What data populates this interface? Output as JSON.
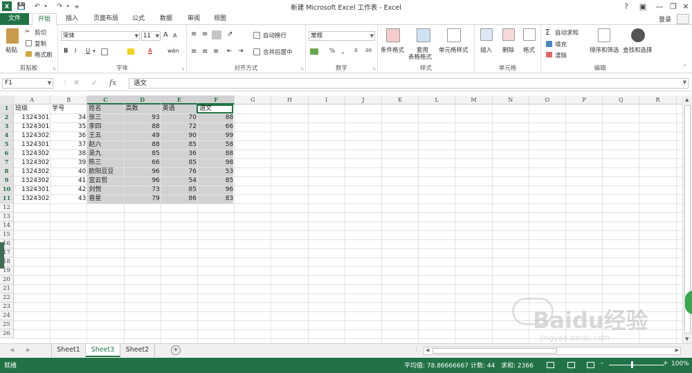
{
  "window": {
    "title": "新建 Microsoft Excel 工作表 - Excel",
    "help": "?",
    "login": "登录"
  },
  "tabs": [
    {
      "label": "文件"
    },
    {
      "label": "开始"
    },
    {
      "label": "插入"
    },
    {
      "label": "页面布局"
    },
    {
      "label": "公式"
    },
    {
      "label": "数据"
    },
    {
      "label": "审阅"
    },
    {
      "label": "视图"
    }
  ],
  "ribbon": {
    "clipboard": {
      "label": "剪贴板",
      "paste": "粘贴",
      "cut": "剪切",
      "copy": "复制",
      "format_painter": "格式刷"
    },
    "font": {
      "label": "字体",
      "font_name": "宋体",
      "font_size": "11",
      "bold": "B",
      "italic": "I",
      "underline": "U",
      "grow": "A",
      "shrink": "A",
      "font_color": "A"
    },
    "alignment": {
      "label": "对齐方式",
      "wrap": "自动换行",
      "merge": "合并后居中"
    },
    "number": {
      "label": "数字",
      "format": "常规",
      "percent": "%",
      "comma": ","
    },
    "styles": {
      "label": "样式",
      "conditional": "条件格式",
      "table1": "套用",
      "table2": "表格格式",
      "cell_styles": "单元格样式"
    },
    "cells": {
      "label": "单元格",
      "insert": "插入",
      "delete": "删除",
      "format": "格式"
    },
    "editing": {
      "label": "编辑",
      "autosum": "自动求和",
      "fill": "填充",
      "clear": "清除",
      "sort": "排序和筛选",
      "find": "查找和选择"
    }
  },
  "formula_bar": {
    "name_box": "F1",
    "fx": "fx",
    "content": "语文"
  },
  "columns": [
    "A",
    "B",
    "C",
    "D",
    "E",
    "F",
    "G",
    "H",
    "I",
    "J",
    "K",
    "L",
    "M",
    "N",
    "O",
    "P",
    "Q",
    "R"
  ],
  "selected_columns": [
    "C",
    "D",
    "E",
    "F"
  ],
  "row_count": 26,
  "selected_rows": 11,
  "header_row": [
    "班级",
    "学号",
    "姓名",
    "高数",
    "英语",
    "语文"
  ],
  "rows": [
    [
      "1324301",
      "34",
      "张三",
      "93",
      "70",
      "88"
    ],
    [
      "1324301",
      "35",
      "李四",
      "88",
      "72",
      "66"
    ],
    [
      "1324302",
      "36",
      "王五",
      "49",
      "90",
      "99"
    ],
    [
      "1324301",
      "37",
      "赵六",
      "88",
      "85",
      "58"
    ],
    [
      "1324302",
      "38",
      "吴九",
      "85",
      "36",
      "88"
    ],
    [
      "1324302",
      "39",
      "陈三",
      "66",
      "85",
      "98"
    ],
    [
      "1324302",
      "40",
      "欧阳豆豆",
      "96",
      "76",
      "53"
    ],
    [
      "1324302",
      "41",
      "宣云哲",
      "96",
      "54",
      "85"
    ],
    [
      "1324301",
      "42",
      "刘悦",
      "73",
      "85",
      "96"
    ],
    [
      "1324302",
      "43",
      "曾星",
      "79",
      "86",
      "83"
    ]
  ],
  "sheets": [
    {
      "label": "Sheet1",
      "active": false
    },
    {
      "label": "Sheet3",
      "active": true
    },
    {
      "label": "Sheet2",
      "active": false
    }
  ],
  "status": {
    "ready": "就绪",
    "average": "平均值: 78.86666667",
    "count": "计数: 44",
    "sum": "求和: 2366",
    "zoom": "100%"
  },
  "watermark": {
    "text": "Baidu经验",
    "sub": "jingyan.baidu.com"
  },
  "colors": {
    "accent": "#217346",
    "selection": "#d2d2d2"
  }
}
